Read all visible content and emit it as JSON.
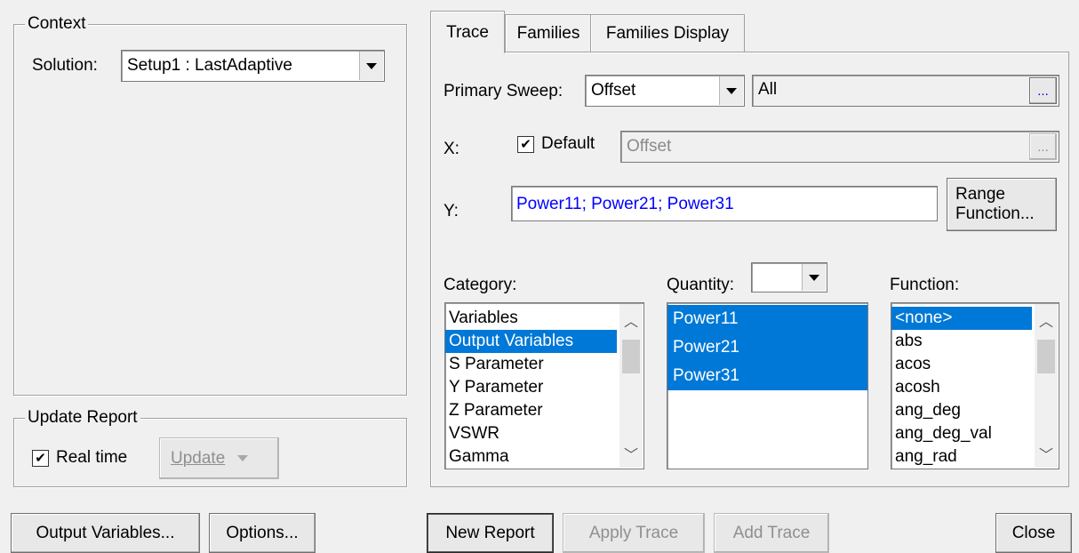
{
  "context": {
    "legend": "Context",
    "solution_label": "Solution:",
    "solution_value": "Setup1 : LastAdaptive"
  },
  "update_report": {
    "legend": "Update Report",
    "realtime_label": "Real time",
    "realtime_checked": true,
    "update_button": "Update"
  },
  "tabs": [
    {
      "label": "Trace",
      "active": true
    },
    {
      "label": "Families",
      "active": false
    },
    {
      "label": "Families Display",
      "active": false
    }
  ],
  "trace": {
    "primary_sweep_label": "Primary Sweep:",
    "primary_sweep_value": "Offset",
    "sweep_range_value": "All",
    "ellipsis": "...",
    "x_label": "X:",
    "default_label": "Default",
    "default_checked": true,
    "x_value": "Offset",
    "y_label": "Y:",
    "y_value": "Power11; Power21; Power31",
    "range_function_button": [
      "Range",
      "Function..."
    ],
    "category_label": "Category:",
    "quantity_label": "Quantity:",
    "function_label": "Function:",
    "categories": [
      "Variables",
      "Output Variables",
      "S Parameter",
      "Y Parameter",
      "Z Parameter",
      "VSWR",
      "Gamma"
    ],
    "category_selected": 1,
    "quantities": [
      "Power11",
      "Power21",
      "Power31"
    ],
    "functions": [
      "<none>",
      "abs",
      "acos",
      "acosh",
      "ang_deg",
      "ang_deg_val",
      "ang_rad"
    ],
    "function_selected": 0
  },
  "bottom": {
    "output_variables": "Output Variables...",
    "options": "Options...",
    "new_report": "New Report",
    "apply_trace": "Apply Trace",
    "add_trace": "Add Trace",
    "close": "Close"
  },
  "colors": {
    "selection": "#0078d7",
    "link_text": "#0000ff"
  }
}
